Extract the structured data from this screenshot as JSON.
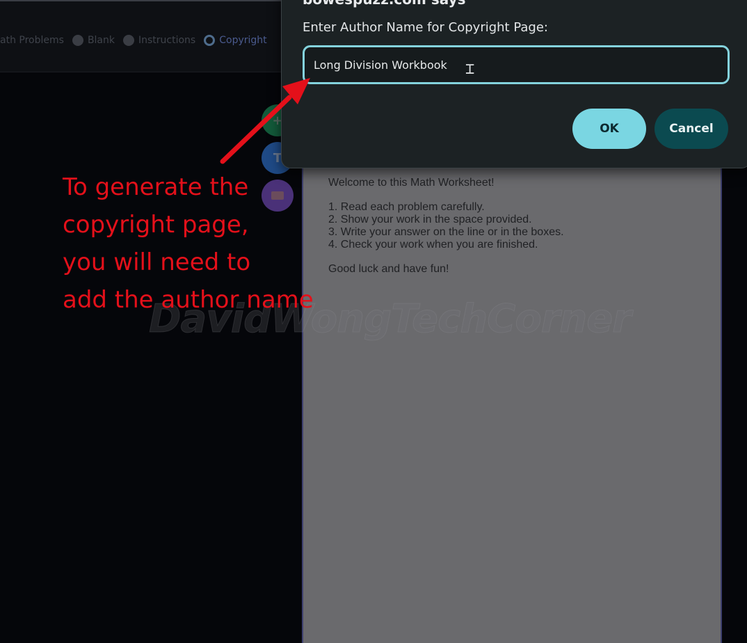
{
  "toolbar": {
    "radio_options": [
      {
        "label": "ath Problems",
        "checked": false,
        "partial": true
      },
      {
        "label": "Blank",
        "checked": false
      },
      {
        "label": "Instructions",
        "checked": false
      },
      {
        "label": "Copyright",
        "checked": true
      }
    ]
  },
  "fab_buttons": [
    {
      "name": "add",
      "glyph": "+"
    },
    {
      "name": "text",
      "glyph": "T"
    },
    {
      "name": "media",
      "glyph": ""
    }
  ],
  "page": {
    "welcome": "Welcome to this Math Worksheet!",
    "steps": [
      "1. Read each problem carefully.",
      "2. Show your work in the space provided.",
      "3. Write your answer on the line or in the boxes.",
      "4. Check your work when you are finished."
    ],
    "closing": "Good luck and have fun!"
  },
  "watermark": "DavidWongTechCorner",
  "dialog": {
    "origin": "bowespuzz.com says",
    "message": "Enter Author Name for Copyright Page:",
    "input_value": "Long Division Workbook",
    "ok_label": "OK",
    "cancel_label": "Cancel"
  },
  "annotation": {
    "lines": [
      "To generate the",
      "copyright page,",
      "you will need to",
      "add the author name"
    ],
    "color": "#e4101a"
  },
  "colors": {
    "accent": "#7ad6e2",
    "cancel": "#0b4a50",
    "input_border": "#84d3dd"
  }
}
